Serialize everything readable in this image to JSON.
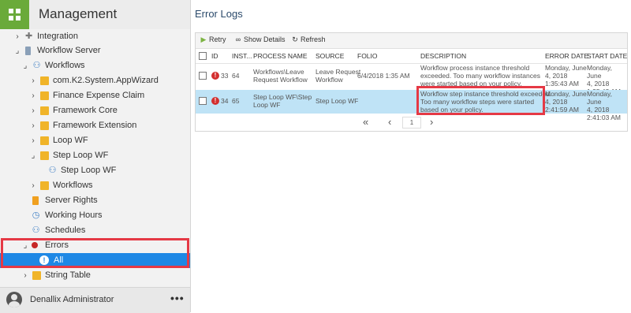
{
  "sidebar": {
    "title": "Management",
    "items": [
      {
        "label": "Integration",
        "chevron": "›",
        "icon": "puzzle-icon"
      },
      {
        "label": "Workflow Server",
        "chevron": "⌟",
        "icon": "server-icon"
      },
      {
        "label": "Workflows",
        "chevron": "⌟",
        "icon": "workflow-icon"
      },
      {
        "label": "com.K2.System.AppWizard",
        "chevron": "›",
        "icon": "folder-icon"
      },
      {
        "label": "Finance Expense Claim",
        "chevron": "›",
        "icon": "folder-icon"
      },
      {
        "label": "Framework Core",
        "chevron": "›",
        "icon": "folder-icon"
      },
      {
        "label": "Framework Extension",
        "chevron": "›",
        "icon": "folder-icon"
      },
      {
        "label": "Loop WF",
        "chevron": "›",
        "icon": "folder-icon"
      },
      {
        "label": "Step Loop WF",
        "chevron": "⌟",
        "icon": "folder-icon"
      },
      {
        "label": "Step Loop WF",
        "chevron": "",
        "icon": "workflow-icon"
      },
      {
        "label": "Workflows",
        "chevron": "›",
        "icon": "folder-icon"
      },
      {
        "label": "Server Rights",
        "chevron": "",
        "icon": "lock-icon"
      },
      {
        "label": "Working Hours",
        "chevron": "",
        "icon": "clock-icon"
      },
      {
        "label": "Schedules",
        "chevron": "",
        "icon": "schedule-icon"
      },
      {
        "label": "Errors",
        "chevron": "⌟",
        "icon": "error-icon"
      },
      {
        "label": "All",
        "chevron": "",
        "icon": "alert-icon"
      },
      {
        "label": "String Table",
        "chevron": "›",
        "icon": "folder-icon"
      }
    ],
    "user": "Denallix Administrator",
    "more": "•••"
  },
  "main": {
    "title": "Error Logs",
    "toolbar": {
      "retry": "Retry",
      "show_details": "Show Details",
      "refresh": "Refresh"
    },
    "columns": [
      "ID",
      "INST...",
      "PROCESS NAME",
      "SOURCE",
      "FOLIO",
      "DESCRIPTION",
      "ERROR DATE",
      "START DATE"
    ],
    "rows": [
      {
        "id": "33",
        "inst": "64",
        "process": [
          "Workflows\\Leave",
          "Request Workflow"
        ],
        "source": [
          "Leave Request",
          "Workflow"
        ],
        "folio": "6/4/2018 1:35 AM",
        "description": [
          "Workflow process instance threshold",
          "exceeded. Too many workflow instances",
          "were started based on your policy."
        ],
        "error_date": [
          "Monday, June",
          "4, 2018",
          "1:35:43 AM"
        ],
        "start_date": [
          "Monday, June",
          "4, 2018",
          "1:35:43 AM"
        ]
      },
      {
        "id": "34",
        "inst": "65",
        "process": [
          "Step Loop WF\\Step",
          "Loop WF"
        ],
        "source": [
          "Step Loop WF"
        ],
        "folio": "",
        "description": [
          "Workflow step instance threshold exceeded.",
          "Too many workflow steps were started",
          "based on your policy."
        ],
        "error_date": [
          "Monday, June",
          "4, 2018",
          "2:41:59 AM"
        ],
        "start_date": [
          "Monday, June",
          "4, 2018",
          "2:41:03 AM"
        ]
      }
    ],
    "pager": {
      "first": "«",
      "prev": "‹",
      "page": "1",
      "next": "›"
    }
  }
}
